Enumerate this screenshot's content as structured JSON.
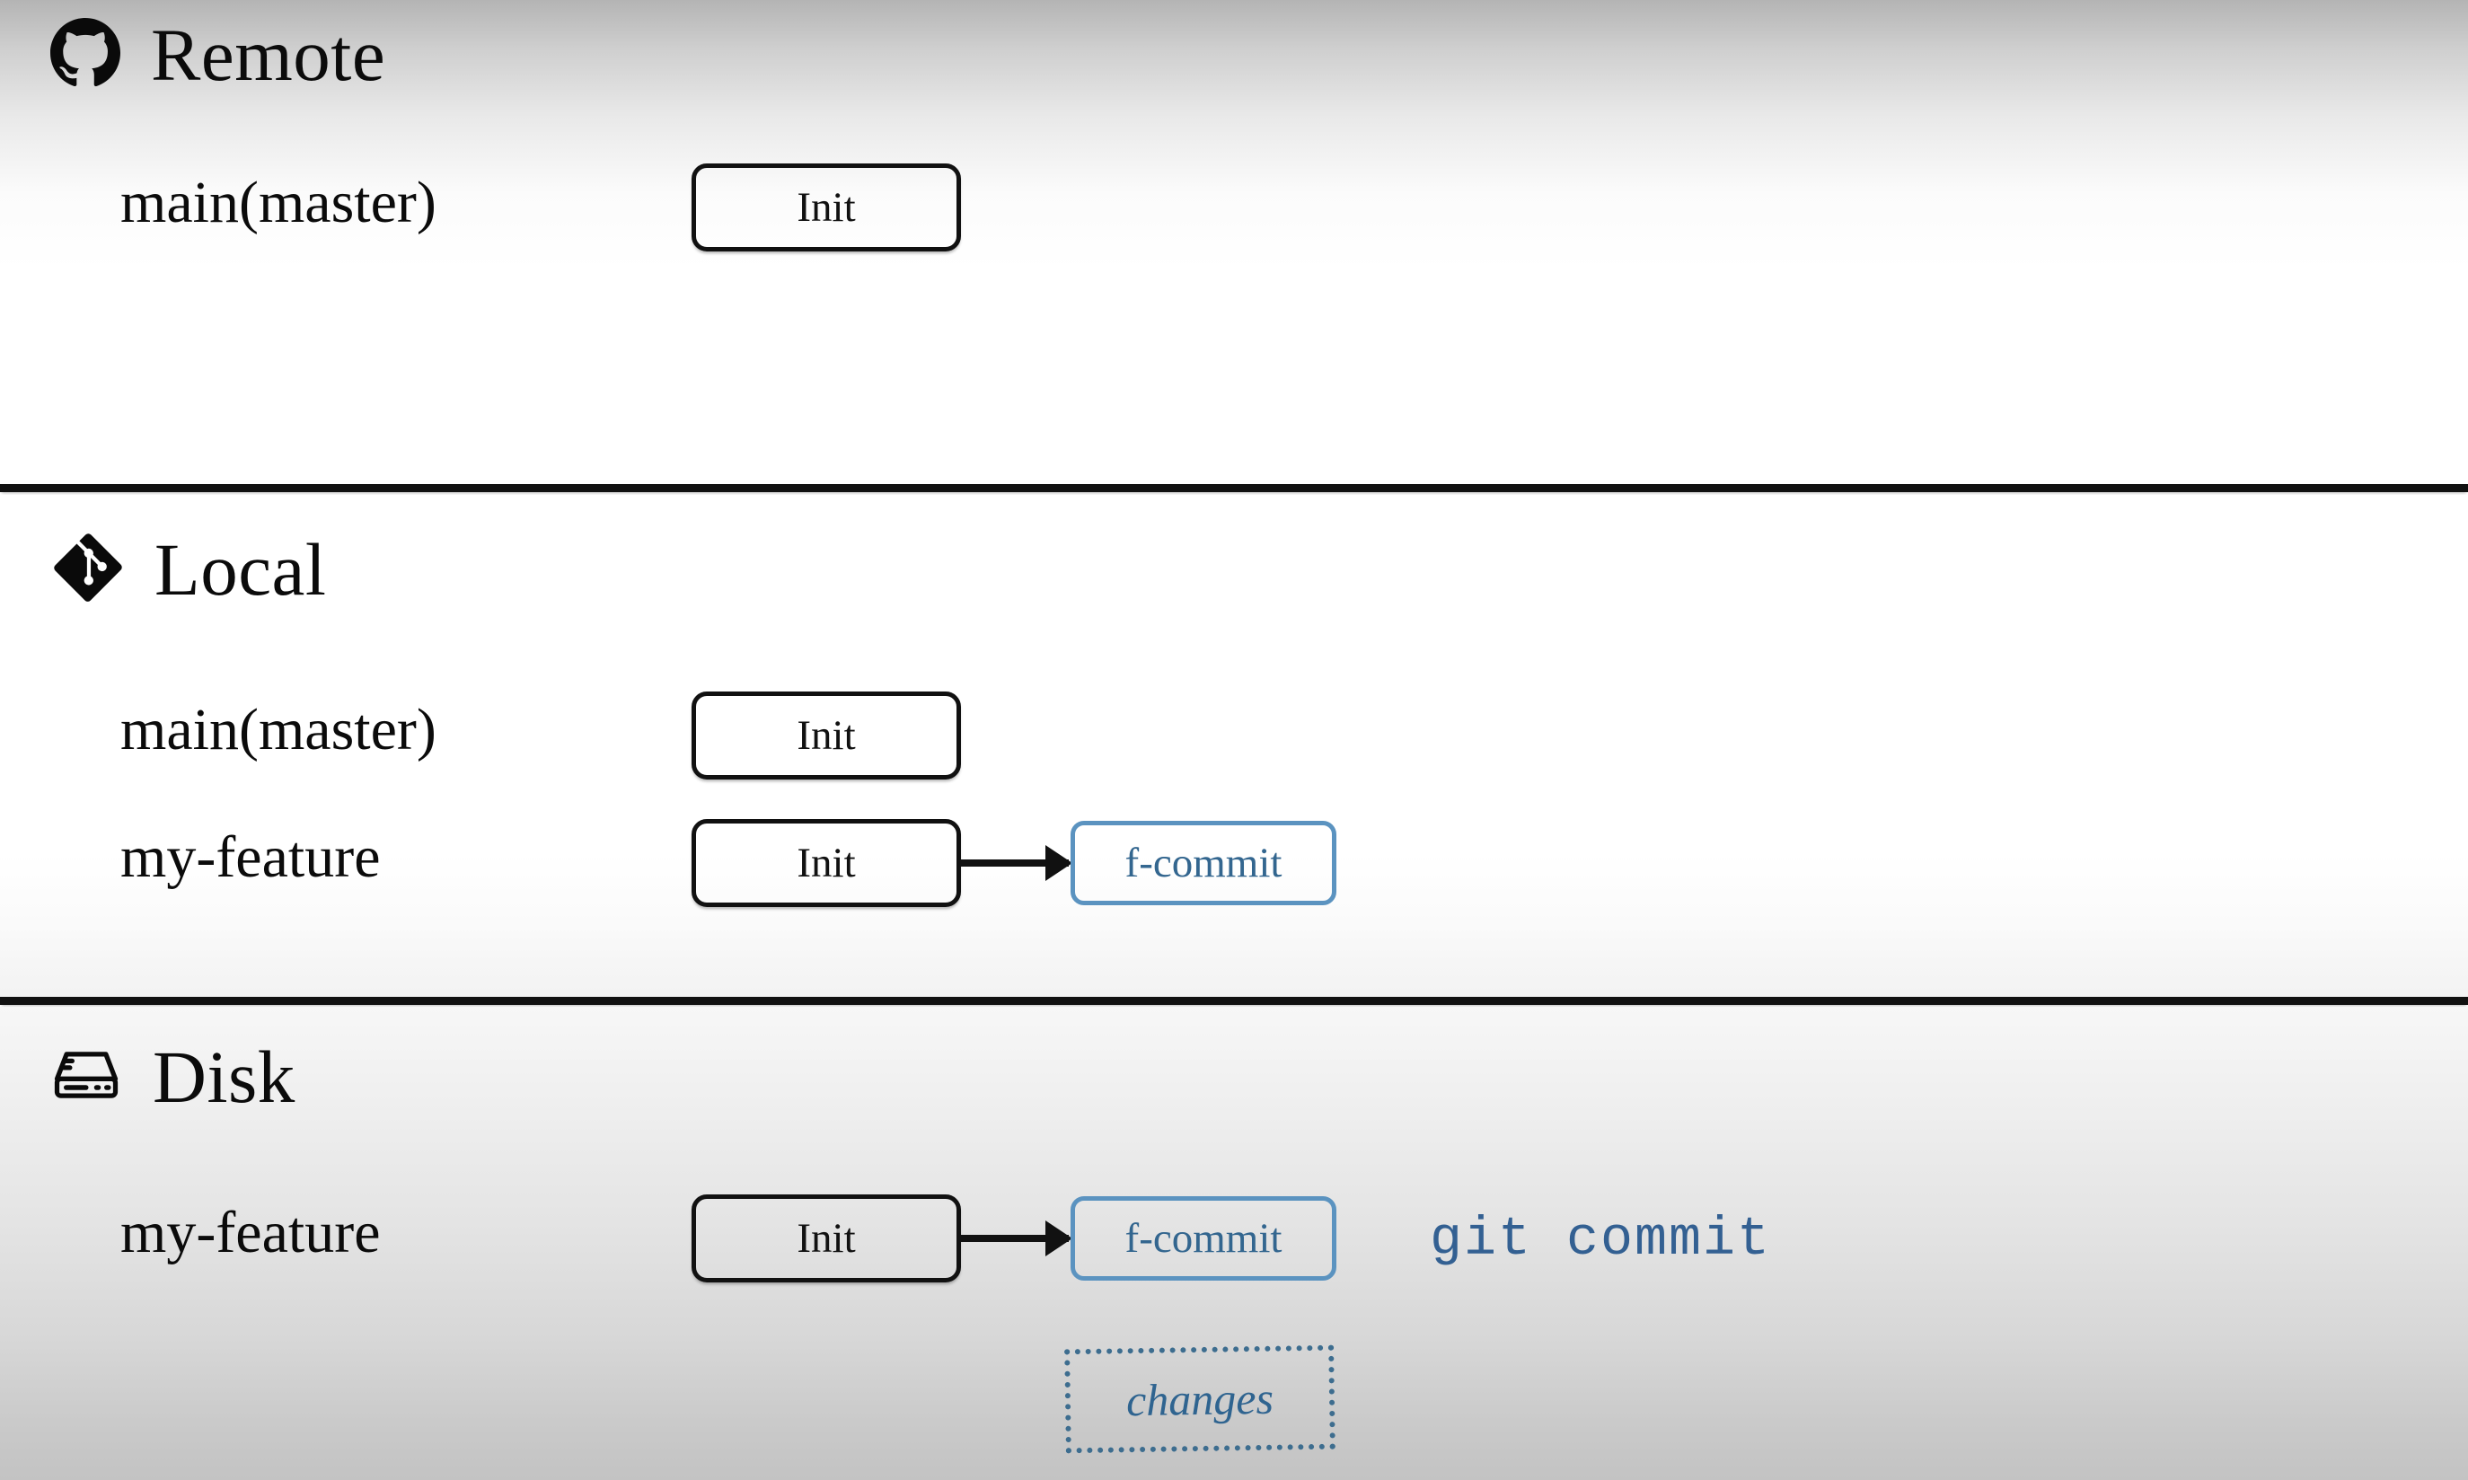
{
  "sections": [
    {
      "id": "remote",
      "title": "Remote",
      "icon": "github-icon",
      "rows": [
        {
          "branch": "main(master)",
          "nodes": [
            {
              "label": "Init",
              "kind": "init"
            }
          ]
        }
      ]
    },
    {
      "id": "local",
      "title": "Local",
      "icon": "git-icon",
      "rows": [
        {
          "branch": "main(master)",
          "nodes": [
            {
              "label": "Init",
              "kind": "init"
            }
          ]
        },
        {
          "branch": "my-feature",
          "nodes": [
            {
              "label": "Init",
              "kind": "init"
            },
            {
              "label": "f-commit",
              "kind": "commit"
            }
          ]
        }
      ]
    },
    {
      "id": "disk",
      "title": "Disk",
      "icon": "harddisk-icon",
      "rows": [
        {
          "branch": "my-feature",
          "nodes": [
            {
              "label": "Init",
              "kind": "init"
            },
            {
              "label": "f-commit",
              "kind": "commit"
            }
          ],
          "command": "git commit",
          "pending": "changes"
        }
      ]
    }
  ],
  "colors": {
    "commit_border": "#5b93c0",
    "commit_text": "#33668f",
    "changes_border": "#3d6d8f",
    "changes_text": "#2f6490",
    "command_text": "#336092",
    "node_border": "#111111",
    "divider": "#111111"
  }
}
